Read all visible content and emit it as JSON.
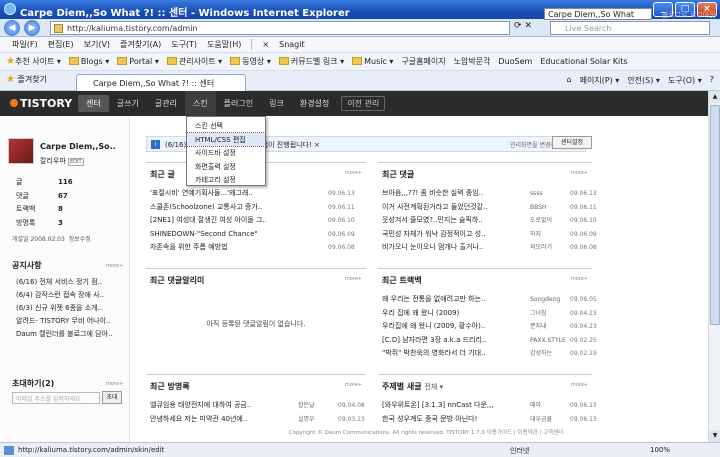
{
  "window": {
    "title": "Carpe Diem,,So What ?! :: 센터 - Windows Internet Explorer",
    "buttons": [
      "_",
      "□",
      "×"
    ]
  },
  "address": {
    "url": "http://kaliuma.tistory.com/admin",
    "search_placeholder": "Live Search"
  },
  "menu": [
    "파일(F)",
    "편집(E)",
    "보기(V)",
    "즐겨찾기(A)",
    "도구(T)",
    "도움말(H)",
    "×",
    "Snagit"
  ],
  "links": [
    "추천 사이트 ▾",
    "Blogs ▾",
    "Portal ▾",
    "관리사이트 ▾",
    "동영상 ▾",
    "커뮤드벨 링크 ▾",
    "Music ▾",
    "구글홈페이지",
    "노암박문각",
    "DuoSem",
    "Educational Solar Kits"
  ],
  "tabs": {
    "favorites": "즐겨찾기",
    "active_tab": "Carpe Diem,,So What ?! :: 센터",
    "tools": [
      "페이지(P) ▾",
      "안전(S) ▾",
      "도구(O) ▾",
      "?"
    ]
  },
  "tistory_nav": {
    "logo": "TISTORY",
    "items": [
      "센터",
      "글쓰기",
      "글관리",
      "스킨",
      "플러그인",
      "링크",
      "환경설정"
    ],
    "prev_admin": "이전 관리",
    "blog_select": "Carpe Diem,,So What",
    "right": "블로그로   로그아웃"
  },
  "skin_menu": [
    "스킨 선택",
    "HTML/CSS 편집",
    "사이드바 설정",
    "화면출력 설정",
    "카테고리 설정"
  ],
  "profile": {
    "name": "Carpe Diem,,So..",
    "user": "칼리우마",
    "edit": "EDIT",
    "stats": [
      {
        "label": "글",
        "value": "116"
      },
      {
        "label": "댓글",
        "value": "67"
      },
      {
        "label": "트랙백",
        "value": "8"
      },
      {
        "label": "방명록",
        "value": "3"
      }
    ],
    "opened": "개설일 2008.02.03",
    "info": "정보수정"
  },
  "notices": {
    "title": "공지사항",
    "more": "more+",
    "items": [
      "(6/16) 전체 서비스 정기 점..",
      "(6/4) 감작스런 접속 장애 사..",
      "(6/3) 신규 위젯 6종을 소개..",
      "알려드- TISTORY 무비 어나이..",
      "Daum 캘린더를 블로그에 담아.."
    ]
  },
  "invite": {
    "title": "초대하기(2)",
    "placeholder": "이메일 주소를 입력하세요",
    "button": "초대"
  },
  "notebar": {
    "text": "(6/16) 전체 서비스 정기 점검 작업이 진행됩니다! ×",
    "change_admin": "관리화면을 변경하려면",
    "center_settings": "센터설정"
  },
  "recent_posts": {
    "title": "최근 글",
    "more": "more+",
    "items": [
      {
        "t": "'표절시비' 연예기획사들...'왜그래..",
        "d": "09.06.13"
      },
      {
        "t": "스쿨존(Schoolzone) 교통사고 증가..",
        "d": "09.06.11"
      },
      {
        "t": "[2NE1] 여성대 잘생긴 여성 아이돌 그..",
        "d": "09.06.10"
      },
      {
        "t": "SHINEDOWN-\"Second Chance\"",
        "d": "09.06.09"
      },
      {
        "t": "자존속을 위한 주름 예방법",
        "d": "09.06.08"
      }
    ]
  },
  "recent_comments": {
    "title": "최근 댓글",
    "more": "more+",
    "items": [
      {
        "t": "브아음,,,??! 좀 비슷한 실력 중임..",
        "w": "ssss",
        "d": "09.06.13"
      },
      {
        "t": "이거 사전계획된거라고 들었던것같..",
        "w": "BBSH",
        "d": "09.06.11"
      },
      {
        "t": "웃성겨서 줄모였?..민지는 슬픽하..",
        "w": "도로없어",
        "d": "09.06.10"
      },
      {
        "t": "국민성 자체가 워낙 감정적이고 성..",
        "w": "하지",
        "d": "09.06.09"
      },
      {
        "t": "비가오니 눈이오니 멈개나 출거나..",
        "w": "외모러기",
        "d": "09.06.08"
      }
    ]
  },
  "comment_alerts": {
    "title": "최근 댓글알리미",
    "more": "more+",
    "empty": "아직 등록된 댓글알림이 없습니다."
  },
  "recent_trackbacks": {
    "title": "최근 트랙백",
    "more": "more+",
    "items": [
      {
        "t": "왜 우리는 전통을 없애려고만 하는..",
        "w": "Songdeng",
        "d": "09.06.05"
      },
      {
        "t": "우리 집에 왜 왔니 (2009)",
        "w": "그녀짐",
        "d": "09.04.23"
      },
      {
        "t": "우리집에 왜 왔니 (2009, 황수아)..",
        "w": "뿐지내",
        "d": "09.04.23"
      },
      {
        "t": "[C.D] 남자라면 3장 a.k.a 드리리..",
        "w": "PAXX STYLE",
        "d": "09.02.25"
      },
      {
        "t": "\"박쥐\" 박찬욱의 영화라서 더 기대..",
        "w": "감성하는",
        "d": "09.02.19"
      }
    ]
  },
  "recent_guestbook": {
    "title": "최근 방명록",
    "more": "more+",
    "items": [
      {
        "t": "엘큐임용 태양전지에 대하여 공금..",
        "w": "잡든날",
        "d": "09.04.08"
      },
      {
        "t": "안녕하세요 저는 미약관 40년에..",
        "w": "실명우",
        "d": "09.03.23"
      }
    ]
  },
  "tag_posts": {
    "title": "주제별 새글",
    "filter": "전체 ▾",
    "more": "more+",
    "items": [
      {
        "t": "[와우위트온] [3.1.3] nnCast 다운,,,",
        "w": "때아",
        "d": "09.06.13"
      },
      {
        "t": "한국 성우계도 중국 문방 아닌다!",
        "w": "대우금쿨",
        "d": "09.06.13"
      }
    ]
  },
  "footer": "Copyright © Daum Communications. All rights reserved. TISTORY 1.7.0  이용가이드 | 이용약관 | 고객센터",
  "statusbar": {
    "text": "http://kaliuma.tistory.com/admin/skin/edit",
    "zone": "인터넷",
    "zoom": "100%"
  }
}
